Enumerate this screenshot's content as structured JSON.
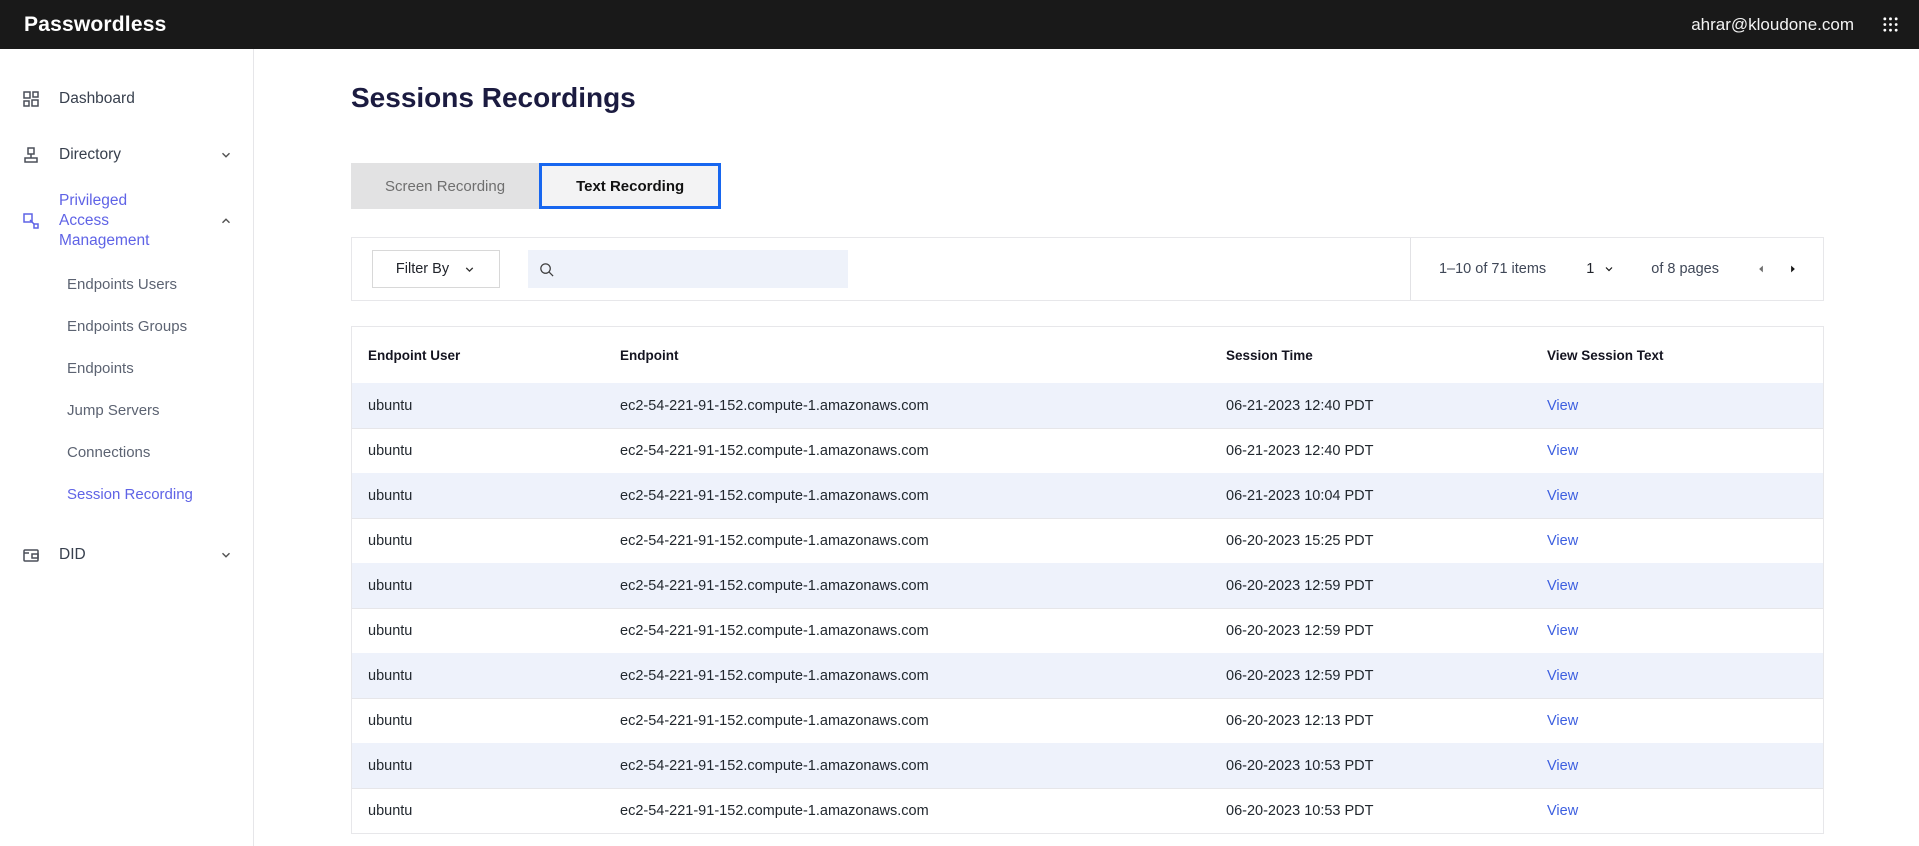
{
  "header": {
    "brand": "Passwordless",
    "user_email": "ahrar@kloudone.com",
    "apps_icon": "grid-dots-icon"
  },
  "sidebar": {
    "dashboard_label": "Dashboard",
    "directory_label": "Directory",
    "pam_label": "Privileged Access Management",
    "pam_items": [
      "Endpoints Users",
      "Endpoints Groups",
      "Endpoints",
      "Jump Servers",
      "Connections",
      "Session Recording"
    ],
    "did_label": "DID",
    "active_item": "Session Recording",
    "icons": [
      "dashboard-icon",
      "directory-icon",
      "pam-vector-icon",
      "wallet-icon"
    ]
  },
  "main": {
    "title": "Sessions Recordings",
    "tabs": [
      {
        "label": "Screen Recording",
        "active": false
      },
      {
        "label": "Text Recording",
        "active": true
      }
    ],
    "filter": {
      "filter_by_label": "Filter By",
      "search_value": "",
      "search_icon": "search-icon"
    },
    "pagination": {
      "items_text": "1–10 of 71 items",
      "page_number": "1",
      "pages_text": "of 8 pages"
    }
  },
  "table": {
    "columns": [
      "Endpoint User",
      "Endpoint",
      "Session Time",
      "View Session Text"
    ],
    "view_label": "View",
    "rows": [
      {
        "user": "ubuntu",
        "endpoint": "ec2-54-221-91-152.compute-1.amazonaws.com",
        "time": "06-21-2023 12:40 PDT"
      },
      {
        "user": "ubuntu",
        "endpoint": "ec2-54-221-91-152.compute-1.amazonaws.com",
        "time": "06-21-2023 12:40 PDT"
      },
      {
        "user": "ubuntu",
        "endpoint": "ec2-54-221-91-152.compute-1.amazonaws.com",
        "time": "06-21-2023 10:04 PDT"
      },
      {
        "user": "ubuntu",
        "endpoint": "ec2-54-221-91-152.compute-1.amazonaws.com",
        "time": "06-20-2023 15:25 PDT"
      },
      {
        "user": "ubuntu",
        "endpoint": "ec2-54-221-91-152.compute-1.amazonaws.com",
        "time": "06-20-2023 12:59 PDT"
      },
      {
        "user": "ubuntu",
        "endpoint": "ec2-54-221-91-152.compute-1.amazonaws.com",
        "time": "06-20-2023 12:59 PDT"
      },
      {
        "user": "ubuntu",
        "endpoint": "ec2-54-221-91-152.compute-1.amazonaws.com",
        "time": "06-20-2023 12:59 PDT"
      },
      {
        "user": "ubuntu",
        "endpoint": "ec2-54-221-91-152.compute-1.amazonaws.com",
        "time": "06-20-2023 12:13 PDT"
      },
      {
        "user": "ubuntu",
        "endpoint": "ec2-54-221-91-152.compute-1.amazonaws.com",
        "time": "06-20-2023 10:53 PDT"
      },
      {
        "user": "ubuntu",
        "endpoint": "ec2-54-221-91-152.compute-1.amazonaws.com",
        "time": "06-20-2023 10:53 PDT"
      }
    ]
  },
  "colors": {
    "topbar_bg": "#191919",
    "accent_indigo": "#5f63e6",
    "tab_active_border": "#1766ef",
    "row_stripe": "#eef2fb",
    "link_blue": "#3d5fe0",
    "search_bg": "#eef2fa"
  }
}
